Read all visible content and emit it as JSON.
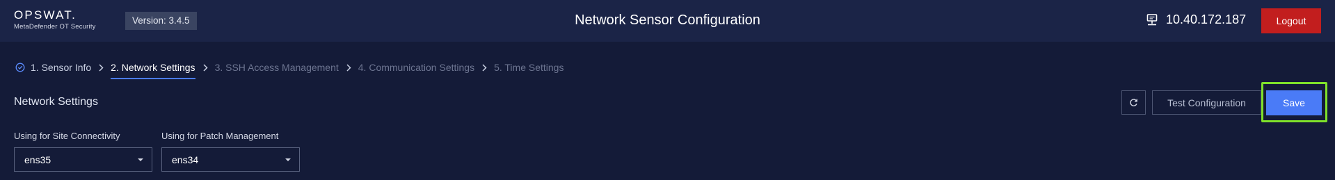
{
  "header": {
    "logo_main": "OPSWAT.",
    "logo_sub": "MetaDefender OT Security",
    "version": "Version: 3.4.5",
    "title": "Network Sensor Configuration",
    "ip": "10.40.172.187",
    "ip_icon": "monitor-network-icon",
    "logout_label": "Logout"
  },
  "steps": [
    {
      "label": "1. Sensor Info",
      "state": "done"
    },
    {
      "label": "2. Network Settings",
      "state": "active"
    },
    {
      "label": "3. SSH Access Management",
      "state": "pending"
    },
    {
      "label": "4. Communication Settings",
      "state": "pending"
    },
    {
      "label": "5. Time Settings",
      "state": "pending"
    }
  ],
  "section": {
    "title": "Network Settings",
    "refresh_icon": "refresh-icon",
    "test_label": "Test Configuration",
    "save_label": "Save"
  },
  "fields": {
    "site": {
      "label": "Using for Site Connectivity",
      "value": "ens35"
    },
    "patch": {
      "label": "Using for Patch Management",
      "value": "ens34"
    }
  },
  "colors": {
    "background": "#141b38",
    "header": "#1b2447",
    "accent": "#4a7bf7",
    "logout": "#c21e1e",
    "highlight": "#7fe12a"
  }
}
